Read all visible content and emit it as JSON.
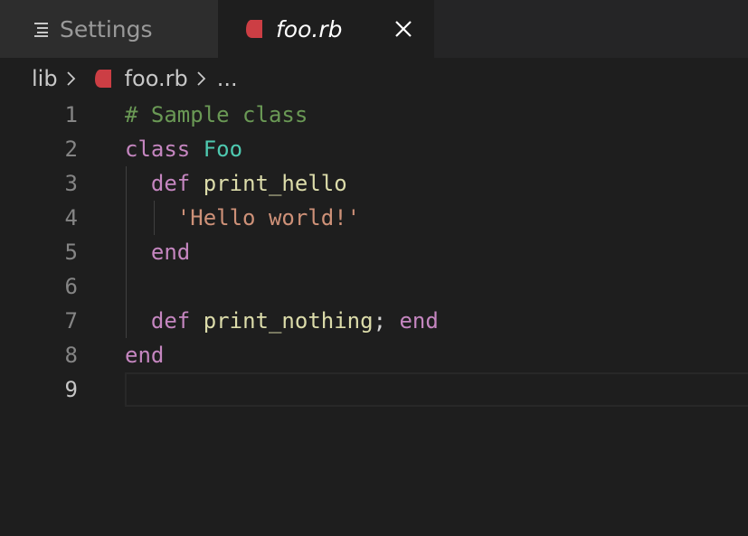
{
  "tabs": [
    {
      "label": "Settings"
    },
    {
      "label": "foo.rb"
    }
  ],
  "breadcrumb": {
    "folder": "lib",
    "file": "foo.rb",
    "more": "..."
  },
  "editor": {
    "line_numbers": [
      "1",
      "2",
      "3",
      "4",
      "5",
      "6",
      "7",
      "8",
      "9"
    ],
    "line1": {
      "comment": "# Sample class"
    },
    "line2": {
      "kw": "class",
      "name": "Foo"
    },
    "line3": {
      "kw": "def",
      "name": "print_hello"
    },
    "line4": {
      "string": "'Hello world!'"
    },
    "line5": {
      "kw": "end"
    },
    "line7": {
      "kw": "def",
      "name": "print_nothing",
      "sep": ";",
      "kw2": "end"
    },
    "line8": {
      "kw": "end"
    }
  },
  "colors": {
    "keyword": "#c586c0",
    "class": "#4ec9b0",
    "function": "#dcdcaa",
    "string": "#ce9178",
    "comment": "#6a9955",
    "ruby_icon": "#cc3e44"
  },
  "icons": [
    "settings-icon",
    "ruby-icon",
    "close-icon",
    "chevron-right-icon"
  ]
}
